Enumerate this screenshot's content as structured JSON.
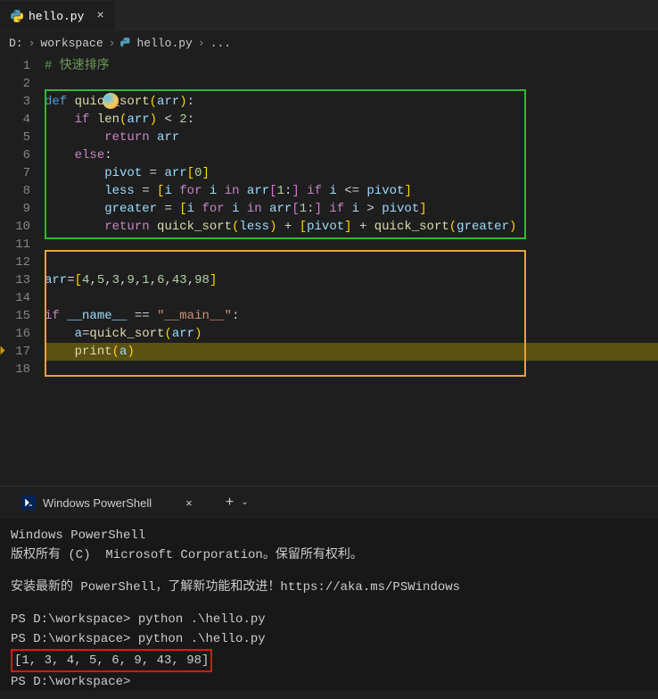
{
  "tab": {
    "label": "hello.py",
    "icon_name": "python-icon"
  },
  "breadcrumb": {
    "parts": [
      "D:",
      "workspace",
      "hello.py",
      "..."
    ],
    "file_icon": "python-icon"
  },
  "editor": {
    "lines": [
      {
        "n": 1,
        "html": "<span class='c-comment'># 快速排序</span>"
      },
      {
        "n": 2,
        "html": ""
      },
      {
        "n": 3,
        "html": "<span class='c-keyword'>def</span> <span class='c-func'>quick_sort</span><span class='c-paren'>(</span><span class='c-var'>arr</span><span class='c-paren'>)</span>:"
      },
      {
        "n": 4,
        "html": "    <span class='c-keyword-flow'>if</span> <span class='c-func'>len</span><span class='c-paren'>(</span><span class='c-var'>arr</span><span class='c-paren'>)</span> <span class='c-op'>&lt;</span> <span class='c-num'>2</span>:"
      },
      {
        "n": 5,
        "html": "        <span class='c-keyword-flow'>return</span> <span class='c-var'>arr</span>"
      },
      {
        "n": 6,
        "html": "    <span class='c-keyword-flow'>else</span>:"
      },
      {
        "n": 7,
        "html": "        <span class='c-var'>pivot</span> <span class='c-op'>=</span> <span class='c-var'>arr</span><span class='c-paren'>[</span><span class='c-num'>0</span><span class='c-paren'>]</span>"
      },
      {
        "n": 8,
        "html": "        <span class='c-var'>less</span> <span class='c-op'>=</span> <span class='c-paren'>[</span><span class='c-var'>i</span> <span class='c-keyword-flow'>for</span> <span class='c-var'>i</span> <span class='c-keyword-flow'>in</span> <span class='c-var'>arr</span><span class='c-paren2'>[</span><span class='c-num'>1</span>:<span class='c-paren2'>]</span> <span class='c-keyword-flow'>if</span> <span class='c-var'>i</span> <span class='c-op'>&lt;=</span> <span class='c-var'>pivot</span><span class='c-paren'>]</span>"
      },
      {
        "n": 9,
        "html": "        <span class='c-var'>greater</span> <span class='c-op'>=</span> <span class='c-paren'>[</span><span class='c-var'>i</span> <span class='c-keyword-flow'>for</span> <span class='c-var'>i</span> <span class='c-keyword-flow'>in</span> <span class='c-var'>arr</span><span class='c-paren2'>[</span><span class='c-num'>1</span>:<span class='c-paren2'>]</span> <span class='c-keyword-flow'>if</span> <span class='c-var'>i</span> <span class='c-op'>&gt;</span> <span class='c-var'>pivot</span><span class='c-paren'>]</span>"
      },
      {
        "n": 10,
        "html": "        <span class='c-keyword-flow'>return</span> <span class='c-func'>quick_sort</span><span class='c-paren'>(</span><span class='c-var'>less</span><span class='c-paren'>)</span> <span class='c-op'>+</span> <span class='c-paren'>[</span><span class='c-var'>pivot</span><span class='c-paren'>]</span> <span class='c-op'>+</span> <span class='c-func'>quick_sort</span><span class='c-paren'>(</span><span class='c-var'>greater</span><span class='c-paren'>)</span>"
      },
      {
        "n": 11,
        "html": ""
      },
      {
        "n": 12,
        "html": ""
      },
      {
        "n": 13,
        "html": "<span class='c-var'>arr</span><span class='c-op'>=</span><span class='c-paren'>[</span><span class='c-num'>4</span>,<span class='c-num'>5</span>,<span class='c-num'>3</span>,<span class='c-num'>9</span>,<span class='c-num'>1</span>,<span class='c-num'>6</span>,<span class='c-num'>43</span>,<span class='c-num'>98</span><span class='c-paren'>]</span>"
      },
      {
        "n": 14,
        "html": ""
      },
      {
        "n": 15,
        "html": "<span class='c-keyword-flow'>if</span> <span class='c-var'>__name__</span> <span class='c-op'>==</span> <span class='c-str'>\"__main__\"</span>:"
      },
      {
        "n": 16,
        "html": "    <span class='c-var'>a</span><span class='c-op'>=</span><span class='c-func'>quick_sort</span><span class='c-paren'>(</span><span class='c-var'>arr</span><span class='c-paren'>)</span>"
      },
      {
        "n": 17,
        "html": "    <span class='c-func'>print</span><span class='c-paren'>(</span><span class='c-var'>a</span><span class='c-paren'>)</span>",
        "highlight": true
      },
      {
        "n": 18,
        "html": ""
      }
    ],
    "highlight_line": 17,
    "green_box": {
      "top_line": 3,
      "bottom_line": 11
    },
    "orange_box": {
      "top_line": 12,
      "bottom_line": 18
    }
  },
  "terminal": {
    "tab_label": "Windows PowerShell",
    "lines": [
      {
        "text": "Windows PowerShell"
      },
      {
        "text": "版权所有 (C)  Microsoft Corporation。保留所有权利。"
      },
      {
        "gap": true
      },
      {
        "text": "安装最新的 PowerShell，了解新功能和改进！https://aka.ms/PSWindows"
      },
      {
        "gap": true
      },
      {
        "prompt": "PS D:\\workspace> ",
        "cmd": "python .\\hello.py"
      },
      {
        "prompt": "PS D:\\workspace> ",
        "cmd": "python .\\hello.py"
      },
      {
        "boxed": "[1, 3, 4, 5, 6, 9, 43, 98]"
      },
      {
        "prompt": "PS D:\\workspace>",
        "cmd": ""
      }
    ]
  }
}
